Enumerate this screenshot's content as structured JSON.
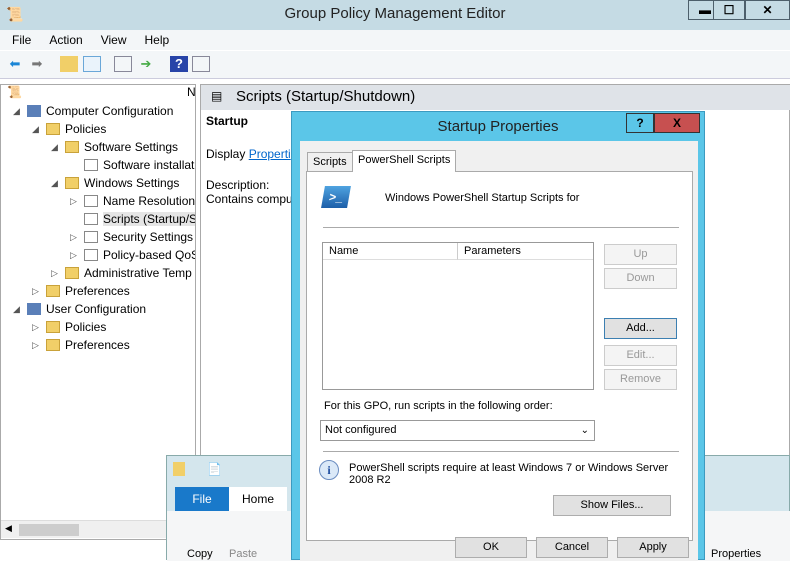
{
  "window": {
    "title": "Group Policy Management Editor",
    "minimize": "▬",
    "maximize": "☐",
    "close": "✕"
  },
  "menu": [
    "File",
    "Action",
    "View",
    "Help"
  ],
  "toolbar_icons": [
    "back-arrow-icon",
    "forward-arrow-icon",
    "up-folder-icon",
    "show-hide-tree-icon",
    "properties-icon",
    "export-list-icon",
    "help-icon",
    "show-action-pane-icon"
  ],
  "tree": {
    "header_col": "N",
    "items": [
      {
        "label": "Computer Configuration",
        "level": 0,
        "expanded": true
      },
      {
        "label": "Policies",
        "level": 1,
        "expanded": true
      },
      {
        "label": "Software Settings",
        "level": 2,
        "expanded": true
      },
      {
        "label": "Software installat",
        "level": 3
      },
      {
        "label": "Windows Settings",
        "level": 2,
        "expanded": true
      },
      {
        "label": "Name Resolution",
        "level": 3,
        "collapsed": true
      },
      {
        "label": "Scripts (Startup/S",
        "level": 3,
        "selected": true
      },
      {
        "label": "Security Settings",
        "level": 3,
        "collapsed": true
      },
      {
        "label": "Policy-based QoS",
        "level": 3,
        "collapsed": true
      },
      {
        "label": "Administrative Temp",
        "level": 2,
        "collapsed": true
      },
      {
        "label": "Preferences",
        "level": 1,
        "collapsed": true
      },
      {
        "label": "User Configuration",
        "level": 0,
        "expanded": true
      },
      {
        "label": "Policies",
        "level": 1,
        "collapsed": true
      },
      {
        "label": "Preferences",
        "level": 1,
        "collapsed": true
      }
    ]
  },
  "right": {
    "header": "Scripts (Startup/Shutdown)",
    "section": "Startup",
    "display_prefix": "Display ",
    "display_link": "Properti",
    "description_label": "Description:",
    "description": "Contains compu"
  },
  "dialog": {
    "title": "Startup Properties",
    "help": "?",
    "close": "X",
    "tabs": [
      "Scripts",
      "PowerShell Scripts"
    ],
    "active_tab": 1,
    "heading": "Windows PowerShell Startup Scripts for",
    "columns": [
      "Name",
      "Parameters"
    ],
    "rows": [],
    "buttons": {
      "up": "Up",
      "down": "Down",
      "add": "Add...",
      "edit": "Edit...",
      "remove": "Remove",
      "show_files": "Show Files..."
    },
    "order_label": "For this GPO, run scripts in the following order:",
    "order_value": "Not configured",
    "info": "PowerShell scripts require at least Windows 7 or Windows Server 2008 R2",
    "footer": {
      "ok": "OK",
      "cancel": "Cancel",
      "apply": "Apply"
    }
  },
  "explorer": {
    "tabs": [
      "File",
      "Home"
    ],
    "copy": "Copy",
    "paste": "Paste",
    "properties": "Properties"
  }
}
